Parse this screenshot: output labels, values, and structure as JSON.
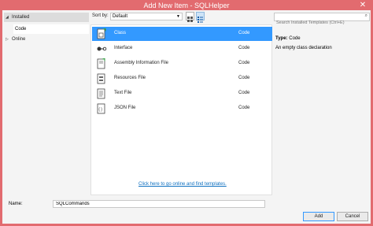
{
  "window": {
    "title": "Add New Item - SQLHelper",
    "min": "–",
    "max": "□",
    "close": "✕"
  },
  "tree": {
    "installed": "Installed",
    "code": "Code",
    "online": "Online"
  },
  "toolbar": {
    "sort_label": "Sort by:",
    "sort_value": "Default",
    "search_placeholder": "Search Installed Templates (Ctrl+E)"
  },
  "items": [
    {
      "name": "Class",
      "category": "Code",
      "icon": "class-file-icon"
    },
    {
      "name": "Interface",
      "category": "Code",
      "icon": "interface-icon"
    },
    {
      "name": "Assembly Information File",
      "category": "Code",
      "icon": "assembly-info-file-icon"
    },
    {
      "name": "Resources File",
      "category": "Code",
      "icon": "resources-file-icon"
    },
    {
      "name": "Text File",
      "category": "Code",
      "icon": "text-file-icon"
    },
    {
      "name": "JSON File",
      "category": "Code",
      "icon": "json-file-icon"
    }
  ],
  "online_link": "Click here to go online and find templates.",
  "details": {
    "type_label": "Type:",
    "type_value": "Code",
    "description": "An empty class declaration"
  },
  "bottom": {
    "name_label": "Name:",
    "name_value": "SQLCommands",
    "add_label": "Add",
    "cancel_label": "Cancel"
  },
  "colors": {
    "titlebar": "#e26b6f",
    "selection": "#3399ff",
    "link": "#0e70c0"
  }
}
